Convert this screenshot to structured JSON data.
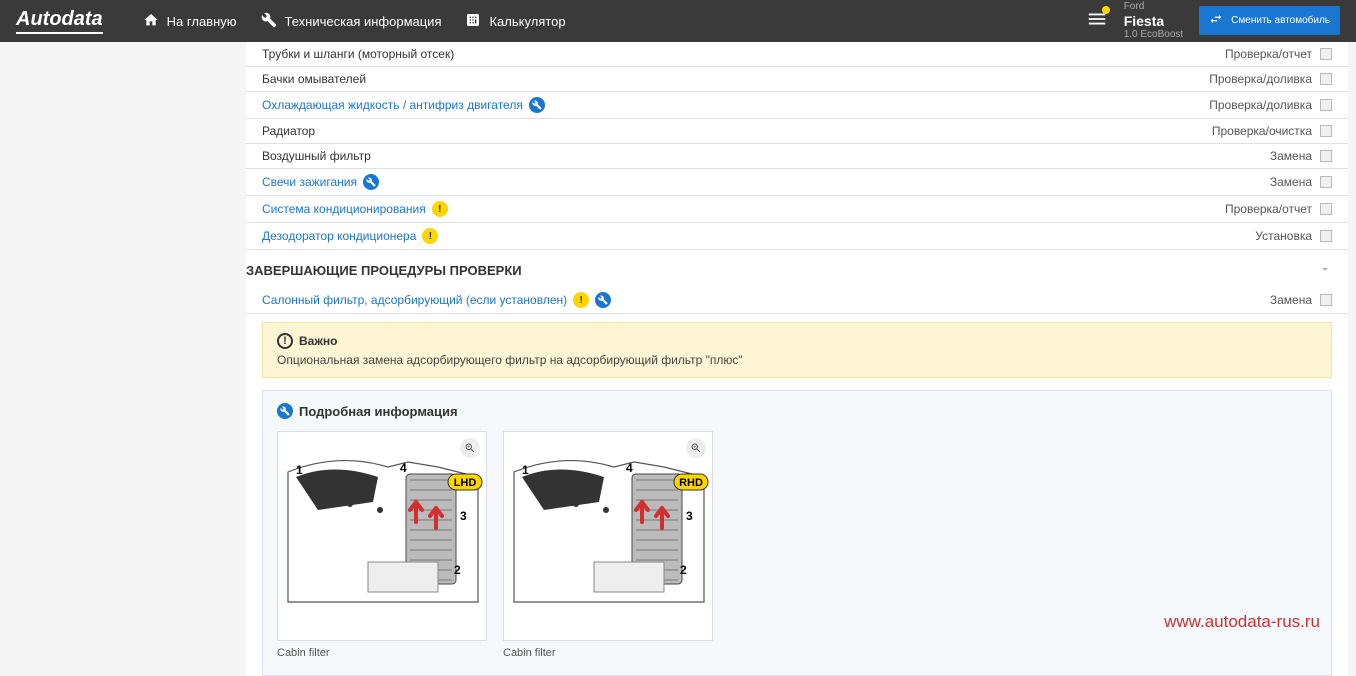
{
  "header": {
    "logo": "Autodata",
    "nav": {
      "home": "На главную",
      "tech": "Техническая информация",
      "calc": "Калькулятор"
    },
    "vehicle": {
      "make": "Ford",
      "model": "Fiesta",
      "engine": "1.0 EcoBoost"
    },
    "swap_btn": "Сменить автомобиль"
  },
  "rows": [
    {
      "label": "Трубки и шланги (моторный отсек)",
      "link": false,
      "badge": null,
      "action": "Проверка/отчет"
    },
    {
      "label": "Бачки омывателей",
      "link": false,
      "badge": null,
      "action": "Проверка/доливка"
    },
    {
      "label": "Охлаждающая жидкость / антифриз двигателя",
      "link": true,
      "badge": "blue",
      "action": "Проверка/доливка"
    },
    {
      "label": "Радиатор",
      "link": false,
      "badge": null,
      "action": "Проверка/очистка"
    },
    {
      "label": "Воздушный фильтр",
      "link": false,
      "badge": null,
      "action": "Замена"
    },
    {
      "label": "Свечи зажигания",
      "link": true,
      "badge": "blue",
      "action": "Замена"
    },
    {
      "label": "Система кондиционирования",
      "link": true,
      "badge": "yellow",
      "action": "Проверка/отчет"
    },
    {
      "label": "Дезодоратор кондиционера",
      "link": true,
      "badge": "yellow",
      "action": "Установка"
    }
  ],
  "section2": {
    "title": "ЗАВЕРШАЮЩИЕ ПРОЦЕДУРЫ ПРОВЕРКИ",
    "row": {
      "label": "Салонный фильтр, адсорбирующий (если установлен)",
      "action": "Замена"
    }
  },
  "alert": {
    "title": "Важно",
    "body": "Опциональная замена адсорбирующего фильтр на адсорбирующий фильтр \"плюс\""
  },
  "info": {
    "title": "Подробная информация",
    "figures": [
      {
        "caption": "Cabin filter",
        "side": "LHD"
      },
      {
        "caption": "Cabin filter",
        "side": "RHD"
      }
    ]
  },
  "watermark": "www.autodata-rus.ru"
}
